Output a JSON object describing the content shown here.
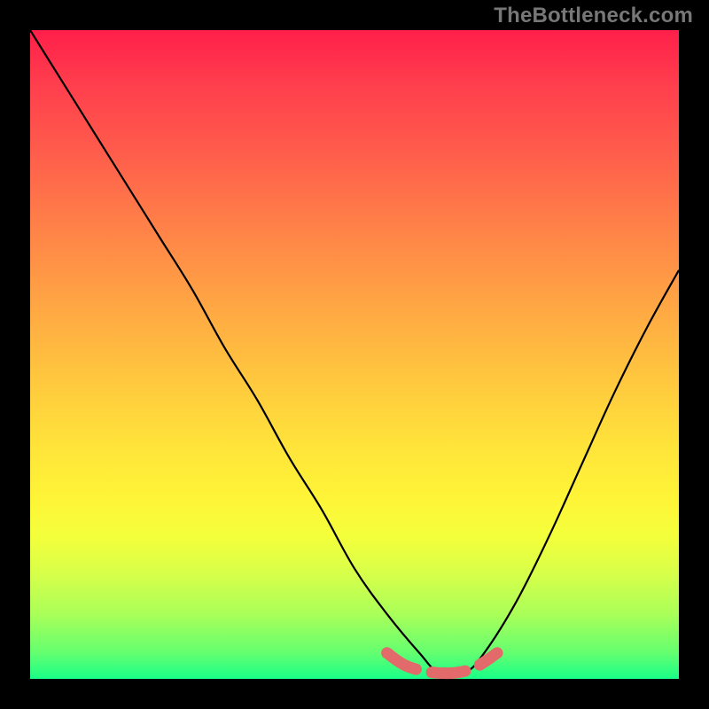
{
  "watermark": "TheBottleneck.com",
  "colors": {
    "curve": "#000000",
    "dashes": "#e26a6a",
    "background_black": "#000000"
  },
  "chart_data": {
    "type": "line",
    "title": "",
    "xlabel": "",
    "ylabel": "",
    "xlim": [
      0,
      100
    ],
    "ylim": [
      0,
      100
    ],
    "grid": false,
    "legend": false,
    "series": [
      {
        "name": "bottleneck-curve",
        "x": [
          0,
          5,
          10,
          15,
          20,
          25,
          30,
          35,
          40,
          45,
          50,
          55,
          60,
          63,
          67,
          70,
          75,
          80,
          85,
          90,
          95,
          100
        ],
        "y": [
          100,
          92,
          84,
          76,
          68,
          60,
          51,
          43,
          34,
          26,
          17,
          10,
          4,
          1,
          1,
          4,
          12,
          22,
          33,
          44,
          54,
          63
        ]
      }
    ],
    "annotations": [
      {
        "name": "highlight-dashes",
        "style": "dashed-pink",
        "x": [
          55,
          58,
          62,
          66,
          69,
          72
        ],
        "y": [
          4,
          2,
          1,
          1,
          2,
          4
        ]
      }
    ]
  }
}
